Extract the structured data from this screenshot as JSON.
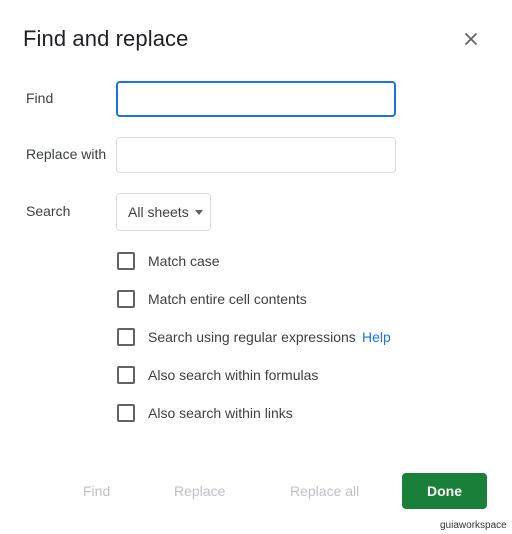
{
  "dialog": {
    "title": "Find and replace",
    "close_icon": "close-icon"
  },
  "find": {
    "label": "Find",
    "value": "",
    "placeholder": ""
  },
  "replace": {
    "label": "Replace with",
    "value": "",
    "placeholder": ""
  },
  "search": {
    "label": "Search",
    "selected": "All sheets"
  },
  "options": [
    {
      "label": "Match case",
      "checked": false
    },
    {
      "label": "Match entire cell contents",
      "checked": false
    },
    {
      "label": "Search using regular expressions",
      "checked": false,
      "help": "Help"
    },
    {
      "label": "Also search within formulas",
      "checked": false
    },
    {
      "label": "Also search within links",
      "checked": false
    }
  ],
  "footer": {
    "find": "Find",
    "replace": "Replace",
    "replace_all": "Replace all",
    "done": "Done"
  },
  "watermark": "guiaworkspace",
  "colors": {
    "accent": "#1a73e8",
    "done_button": "#188038",
    "disabled_text": "#bdc1c6"
  }
}
